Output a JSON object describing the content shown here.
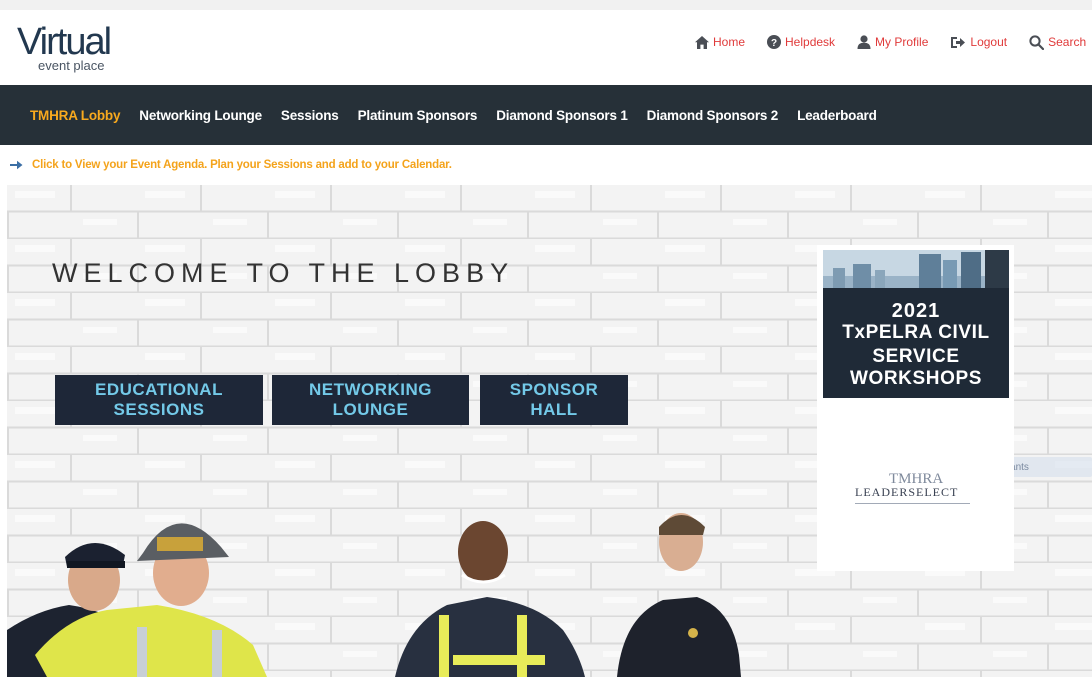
{
  "logo": {
    "main": "Virtual",
    "sub": "event place"
  },
  "topnav": {
    "items": [
      {
        "label": "Home",
        "icon": "home-icon"
      },
      {
        "label": "Helpdesk",
        "icon": "help-circle-icon"
      },
      {
        "label": "My Profile",
        "icon": "user-icon"
      },
      {
        "label": "Logout",
        "icon": "logout-icon"
      },
      {
        "label": "Search",
        "icon": "search-icon"
      }
    ]
  },
  "mainnav": {
    "items": [
      {
        "label": "TMHRA Lobby",
        "active": true
      },
      {
        "label": "Networking Lounge"
      },
      {
        "label": "Sessions"
      },
      {
        "label": "Platinum Sponsors"
      },
      {
        "label": "Diamond Sponsors 1"
      },
      {
        "label": "Diamond Sponsors 2"
      },
      {
        "label": "Leaderboard"
      }
    ]
  },
  "agenda": {
    "text": "Click to View your Event Agenda. Plan your Sessions and add to your Calendar.",
    "icon": "arrow-right-icon"
  },
  "hero": {
    "welcome": "WELCOME TO THE LOBBY",
    "buttons": [
      {
        "line1": "EDUCATIONAL",
        "line2": "SESSIONS"
      },
      {
        "line1": "NETWORKING",
        "line2": "LOUNGE"
      },
      {
        "line1": "SPONSOR",
        "line2": "HALL"
      }
    ],
    "faint_button": "Restaurants"
  },
  "promo": {
    "year": "2021",
    "line1": "TxPELRA CIVIL",
    "line2": "SERVICE",
    "line3": "WORKSHOPS"
  },
  "sponsor": {
    "top": "TMHRA",
    "bottom": "LEADERSELECT"
  },
  "colors": {
    "nav_bg": "#263038",
    "accent": "#f8a91e",
    "topnav_link": "#e03a3a",
    "hero_button_bg": "#1e2738",
    "hero_button_text": "#73c9e8",
    "promo_bg": "#1f2a37"
  }
}
